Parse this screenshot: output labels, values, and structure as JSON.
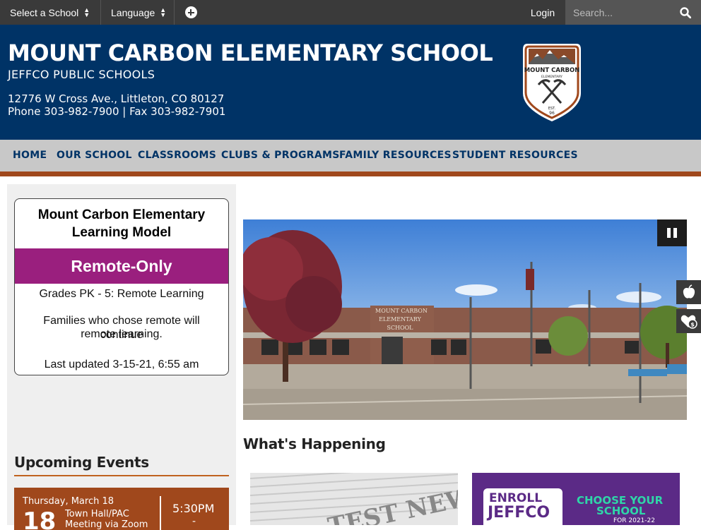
{
  "topbar": {
    "select_school": "Select a School",
    "language": "Language",
    "login": "Login",
    "search_placeholder": "Search..."
  },
  "header": {
    "school_name": "MOUNT CARBON ELEMENTARY SCHOOL",
    "district": "JEFFCO PUBLIC SCHOOLS",
    "address": "12776 W Cross Ave., Littleton, CO 80127",
    "phone": "Phone 303-982-7900 | Fax 303-982-7901",
    "logo_text_1": "MOUNT CARBON",
    "logo_text_2": "ELEMENTARY",
    "logo_est_1": "EST.",
    "logo_est_2": "96"
  },
  "nav": {
    "items": [
      "HOME",
      "OUR SCHOOL",
      "CLASSROOMS",
      "CLUBS & PROGRAMS",
      "FAMILY RESOURCES",
      "STUDENT RESOURCES"
    ]
  },
  "learning_model": {
    "title_1": "Mount Carbon Elementary",
    "title_2": "Learning Model",
    "status": "Remote-Only",
    "line_1": "Grades PK - 5: Remote Learning",
    "line_2a": "Families who chose remote will continue",
    "line_2b": "remote learning.",
    "updated": "Last updated 3-15-21, 6:55 am"
  },
  "events": {
    "heading": "Upcoming Events",
    "items": [
      {
        "date": "Thursday, March 18",
        "day": "18",
        "name": "Town Hall/PAC Meeting via Zoom",
        "time": "5:30PM",
        "dash": "-"
      }
    ]
  },
  "slideshow": {
    "sign_1": "MOUNT CARBON",
    "sign_2": "ELEMENTARY",
    "sign_3": "SCHOOL"
  },
  "whats_happening": {
    "heading": "What's Happening",
    "news_text": "TEST NEWS",
    "enroll_1": "ENROLL",
    "enroll_2": "JEFFCO",
    "choose_1": "CHOOSE YOUR",
    "choose_2": "SCHOOL",
    "choose_3": "FOR 2021-22"
  },
  "colors": {
    "topbar": "#3a3a3a",
    "header": "#003366",
    "nav_bg": "#c8c8c8",
    "accent_rust": "#a0481c",
    "remote_banner": "#9a1f7e",
    "enroll_purple": "#5b2a86"
  }
}
